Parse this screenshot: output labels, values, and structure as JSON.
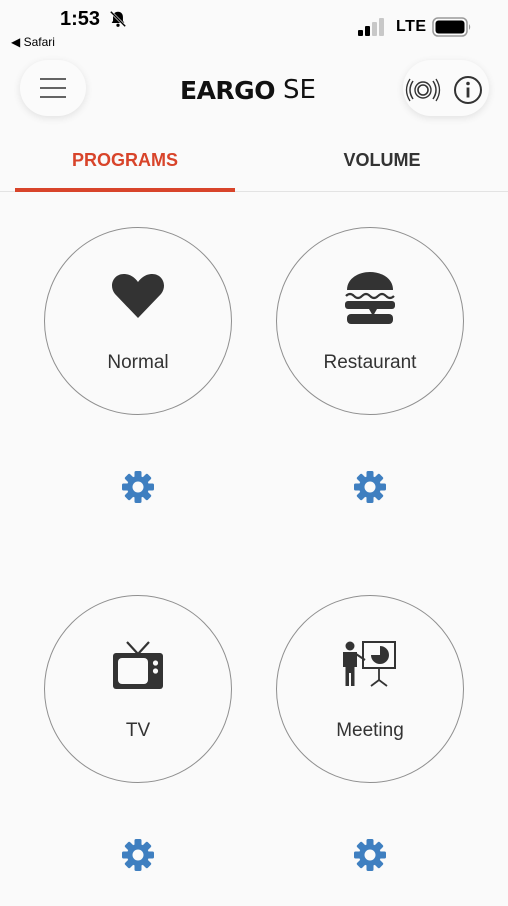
{
  "status_bar": {
    "time": "1:53",
    "back_app": "◀ Safari",
    "carrier": "LTE"
  },
  "header": {
    "logo_main": "EARGO",
    "logo_sub": "SE"
  },
  "tabs": [
    {
      "label": "PROGRAMS",
      "active": true
    },
    {
      "label": "VOLUME",
      "active": false
    }
  ],
  "programs": [
    {
      "label": "Normal",
      "icon": "heart-icon"
    },
    {
      "label": "Restaurant",
      "icon": "burger-icon"
    },
    {
      "label": "TV",
      "icon": "tv-icon"
    },
    {
      "label": "Meeting",
      "icon": "presentation-icon"
    }
  ],
  "colors": {
    "accent": "#d8442a",
    "gear": "#3f7fc0",
    "icon": "#333333"
  }
}
